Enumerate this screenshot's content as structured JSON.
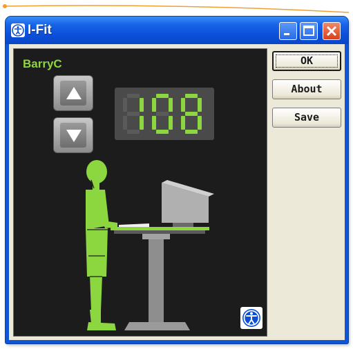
{
  "window": {
    "title": "I-Fit",
    "controls": [
      "minimize",
      "maximize",
      "close"
    ]
  },
  "panel": {
    "username": "BarryC",
    "height_display": "108",
    "arrow_up_icon": "arrow-up-icon",
    "arrow_down_icon": "arrow-down-icon",
    "badge_icon": "accessibility-icon"
  },
  "buttons": {
    "ok_label": "OK",
    "about_label": "About",
    "save_label": "Save"
  },
  "colors": {
    "titlebar": "#0b4ed8",
    "panel_bg": "#1c1c1c",
    "accent_green": "#8cd640",
    "dialog_face": "#ece9d8"
  }
}
